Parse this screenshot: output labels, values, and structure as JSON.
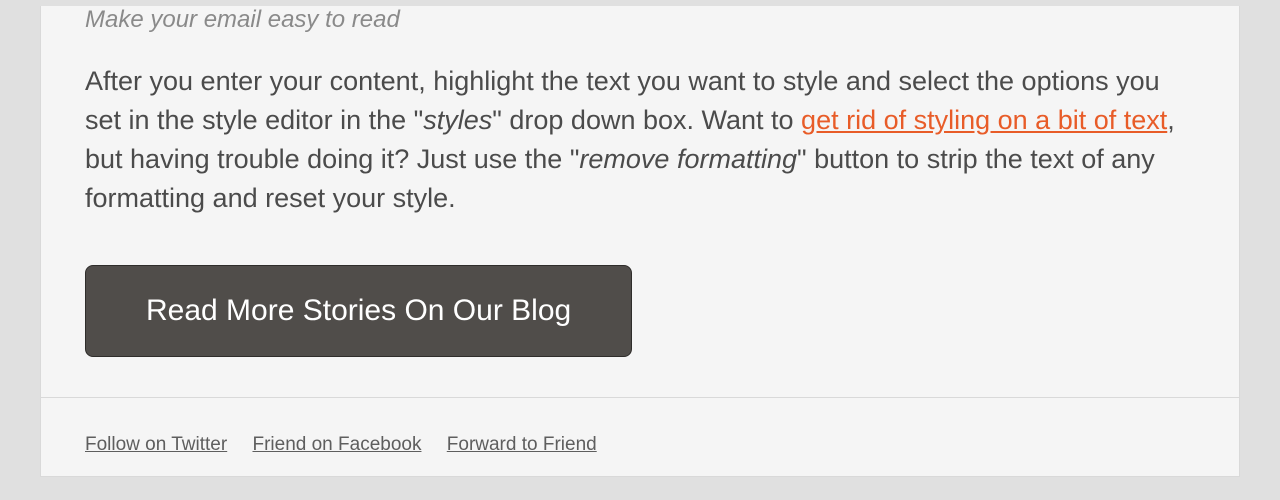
{
  "content": {
    "subtitle": "Make your email easy to read",
    "body": {
      "part1": "After you enter your content, highlight the text you want to style and select the options you set in the style editor in the \"",
      "italic1": "styles",
      "part2": "\" drop down box. Want to ",
      "link_text": "get rid of styling on a bit of text",
      "part3": ", but having trouble doing it? Just use the \"",
      "italic2": "remove formatting",
      "part4": "\" button to strip the text of any formatting and reset your style."
    },
    "cta_label": "Read More Stories On Our Blog"
  },
  "footer": {
    "links": {
      "twitter": "Follow on Twitter",
      "facebook": "Friend on Facebook",
      "forward": "Forward to Friend"
    }
  }
}
